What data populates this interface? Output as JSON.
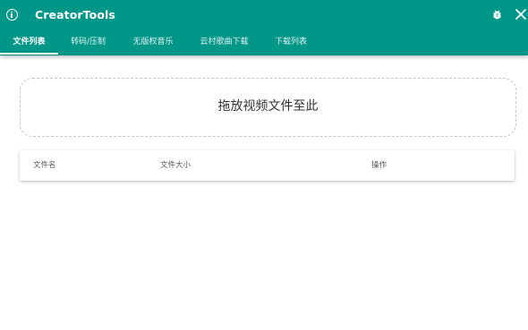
{
  "header": {
    "title": "CreatorTools",
    "info_icon": "info-icon",
    "bug_icon": "bug-icon",
    "close_icon": "close-icon",
    "color": "#009688"
  },
  "tabs": [
    {
      "label": "文件列表",
      "active": true
    },
    {
      "label": "转码/压制",
      "active": false
    },
    {
      "label": "无版权音乐",
      "active": false
    },
    {
      "label": "云村歌曲下载",
      "active": false
    },
    {
      "label": "下载列表",
      "active": false
    }
  ],
  "dropzone": {
    "label": "拖放视频文件至此"
  },
  "file_table": {
    "columns": [
      "文件名",
      "文件大小",
      "操作"
    ],
    "rows": []
  }
}
